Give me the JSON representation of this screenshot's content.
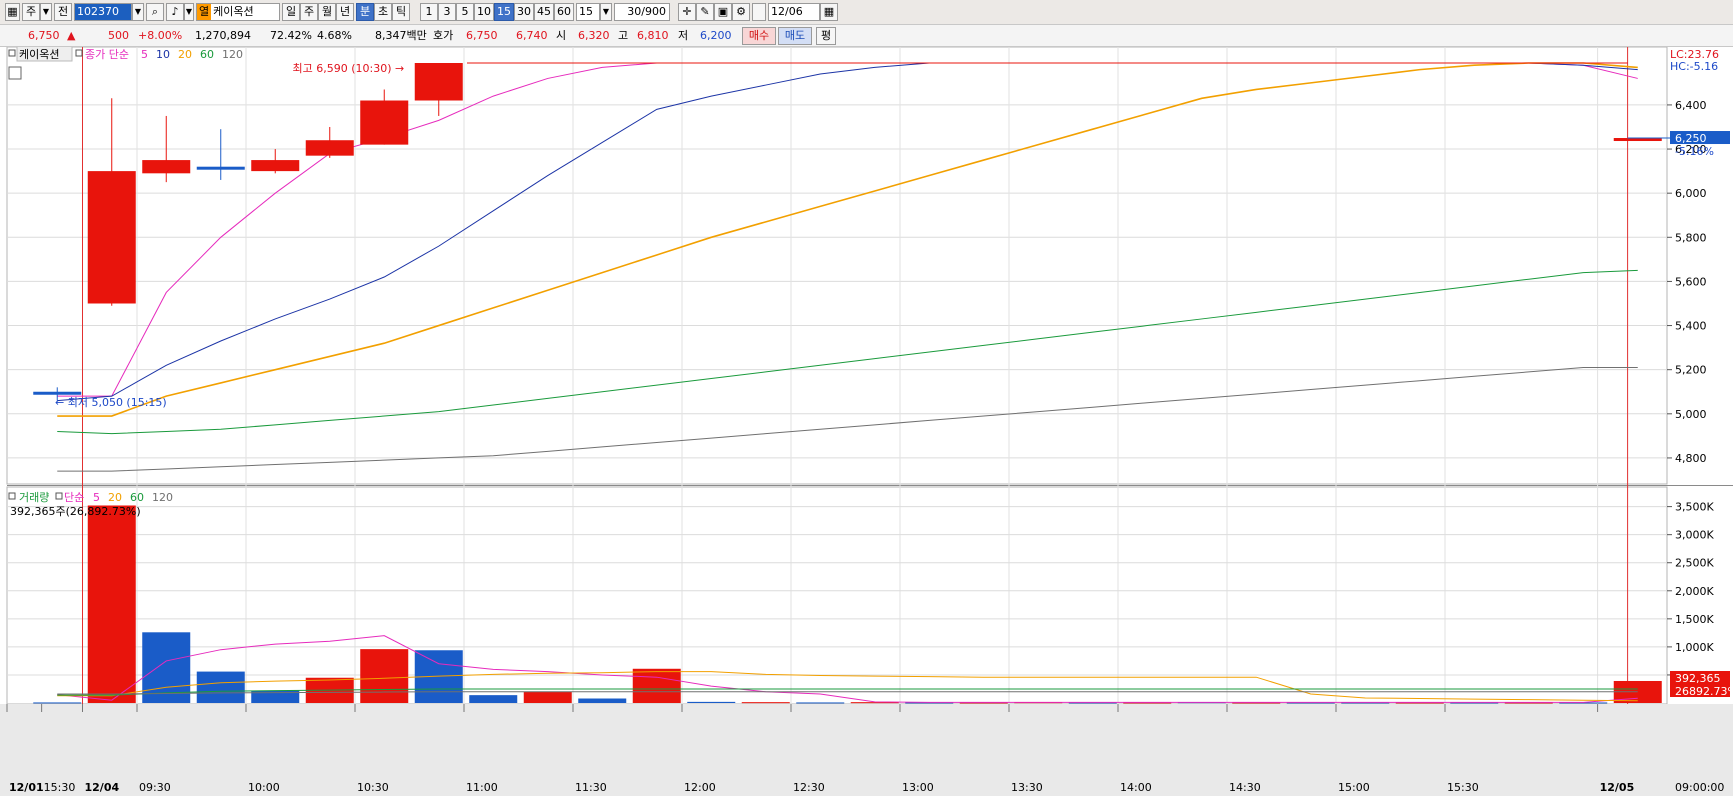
{
  "toolbar": {
    "day_label": "주",
    "prev_label": "전",
    "code": "102370",
    "name_tag": "열",
    "name": "케이옥션",
    "periods": [
      "일",
      "주",
      "월",
      "년",
      "분",
      "초",
      "틱"
    ],
    "selected_period": "분",
    "intervals": [
      "1",
      "3",
      "5",
      "10",
      "15",
      "30",
      "45",
      "60"
    ],
    "selected_interval": "15",
    "interval_value": "15",
    "count": "30/900",
    "date": "12/06",
    "dropdown_arrow": "▼",
    "icons": [
      "chart-type-icon",
      "search-icon",
      "sound-icon",
      "crosshair-icon",
      "draw-icon",
      "save-icon",
      "settings-icon",
      "calendar-icon"
    ]
  },
  "quote": {
    "price": "6,750",
    "change_arrow": "▲",
    "change": "500",
    "change_pct": "+8.00%",
    "volume": "1,270,894",
    "vol_ratio": "72.42%",
    "turnover": "4.68%",
    "amount": "8,347백만",
    "hoga_label": "호가",
    "ask": "6,750",
    "bid": "6,740",
    "open_label": "시",
    "open": "6,320",
    "high_label": "고",
    "high": "6,810",
    "low_label": "저",
    "low": "6,200",
    "buy_label": "매수",
    "sell_label": "매도",
    "avg_label": "평"
  },
  "colors": {
    "up": "#e8140c",
    "down": "#1a5cc8",
    "ma5": "#e62bbd",
    "ma10": "#1c34a6",
    "ma20": "#f2a000",
    "ma60": "#1a9a3c",
    "ma120": "#707070"
  },
  "chart_data": [
    {
      "type": "candlestick",
      "legend": {
        "title": "케이옥션",
        "ma_label": "종가 단순",
        "periods": [
          "5",
          "10",
          "20",
          "60",
          "120"
        ]
      },
      "right_label_lc": "LC:23.76",
      "right_label_hc": "HC:-5.16",
      "current_tag": "6,250",
      "current_pct": "-5.16%",
      "high_annotation": "최고 6,590 (10:30)",
      "low_annotation": "최저 5,050 (15:15)",
      "y_ticks": [
        "6,400",
        "6,200",
        "6,000",
        "5,800",
        "5,600",
        "5,400",
        "5,200",
        "5,000",
        "4,800"
      ],
      "y_tick_values": [
        6400,
        6200,
        6000,
        5800,
        5600,
        5400,
        5200,
        5000,
        4800
      ],
      "candles": [
        {
          "o": 5100,
          "h": 5120,
          "l": 5060,
          "c": 5100
        },
        {
          "o": 5500,
          "h": 6430,
          "l": 5490,
          "c": 6100
        },
        {
          "o": 6090,
          "h": 6350,
          "l": 6050,
          "c": 6150
        },
        {
          "o": 6120,
          "h": 6290,
          "l": 6060,
          "c": 6120
        },
        {
          "o": 6100,
          "h": 6200,
          "l": 6090,
          "c": 6150
        },
        {
          "o": 6170,
          "h": 6300,
          "l": 6160,
          "c": 6240
        },
        {
          "o": 6220,
          "h": 6470,
          "l": 6220,
          "c": 6420
        },
        {
          "o": 6420,
          "h": 6590,
          "l": 6350,
          "c": 6590
        },
        {
          "o": 6590,
          "h": 6590,
          "l": 6590,
          "c": 6590
        },
        {
          "o": 6590,
          "h": 6590,
          "l": 6590,
          "c": 6590
        },
        {
          "o": 6590,
          "h": 6590,
          "l": 6470,
          "c": 6590
        },
        {
          "o": 6590,
          "h": 6590,
          "l": 6590,
          "c": 6590
        },
        {
          "o": 6590,
          "h": 6590,
          "l": 6590,
          "c": 6590
        },
        {
          "o": 6590,
          "h": 6590,
          "l": 6590,
          "c": 6590
        },
        {
          "o": 6590,
          "h": 6590,
          "l": 6590,
          "c": 6590
        },
        {
          "o": 6590,
          "h": 6590,
          "l": 6590,
          "c": 6590
        },
        {
          "o": 6590,
          "h": 6590,
          "l": 6590,
          "c": 6590
        },
        {
          "o": 6590,
          "h": 6590,
          "l": 6590,
          "c": 6590
        },
        {
          "o": 6590,
          "h": 6590,
          "l": 6590,
          "c": 6590
        },
        {
          "o": 6590,
          "h": 6590,
          "l": 6590,
          "c": 6590
        },
        {
          "o": 6590,
          "h": 6590,
          "l": 6590,
          "c": 6590
        },
        {
          "o": 6590,
          "h": 6590,
          "l": 6590,
          "c": 6590
        },
        {
          "o": 6590,
          "h": 6590,
          "l": 6590,
          "c": 6590
        },
        {
          "o": 6590,
          "h": 6590,
          "l": 6590,
          "c": 6590
        },
        {
          "o": 6590,
          "h": 6590,
          "l": 6590,
          "c": 6590
        },
        {
          "o": 6590,
          "h": 6590,
          "l": 6590,
          "c": 6590
        },
        {
          "o": 6590,
          "h": 6590,
          "l": 6590,
          "c": 6590
        },
        {
          "o": 6590,
          "h": 6590,
          "l": 6590,
          "c": 6590
        },
        {
          "o": 6590,
          "h": 6590,
          "l": 6590,
          "c": 6590
        },
        {
          "o": 6250,
          "h": 6250,
          "l": 6250,
          "c": 6250
        }
      ],
      "ma_series": [
        {
          "period": "5",
          "values": [
            5080,
            5080,
            5550,
            5800,
            6000,
            6180,
            6250,
            6330,
            6440,
            6520,
            6570,
            6590,
            6590,
            6590,
            6590,
            6590,
            6590,
            6590,
            6590,
            6590,
            6590,
            6590,
            6590,
            6590,
            6590,
            6590,
            6590,
            6590,
            6580,
            6520
          ]
        },
        {
          "period": "10",
          "values": [
            5060,
            5080,
            5220,
            5330,
            5430,
            5520,
            5620,
            5760,
            5920,
            6080,
            6230,
            6380,
            6440,
            6490,
            6540,
            6570,
            6590,
            6590,
            6590,
            6590,
            6590,
            6590,
            6590,
            6590,
            6590,
            6590,
            6590,
            6590,
            6580,
            6560
          ]
        },
        {
          "period": "20",
          "values": [
            4990,
            4990,
            5080,
            5140,
            5200,
            5260,
            5320,
            5400,
            5480,
            5560,
            5640,
            5720,
            5800,
            5870,
            5940,
            6010,
            6080,
            6150,
            6220,
            6290,
            6360,
            6430,
            6470,
            6500,
            6530,
            6560,
            6580,
            6590,
            6590,
            6570
          ]
        },
        {
          "period": "60",
          "values": [
            4920,
            4910,
            4920,
            4930,
            4950,
            4970,
            4990,
            5010,
            5040,
            5070,
            5100,
            5130,
            5160,
            5190,
            5220,
            5250,
            5280,
            5310,
            5340,
            5370,
            5400,
            5430,
            5460,
            5490,
            5520,
            5550,
            5580,
            5610,
            5640,
            5650
          ]
        },
        {
          "period": "120",
          "values": [
            4740,
            4740,
            4750,
            4760,
            4770,
            4780,
            4790,
            4800,
            4810,
            4830,
            4850,
            4870,
            4890,
            4910,
            4930,
            4950,
            4970,
            4990,
            5010,
            5030,
            5050,
            5070,
            5090,
            5110,
            5130,
            5150,
            5170,
            5190,
            5210,
            5210
          ]
        }
      ]
    },
    {
      "type": "bar",
      "legend": {
        "title": "거래량",
        "ma_label": "단순",
        "periods": [
          "5",
          "20",
          "60",
          "120"
        ]
      },
      "summary": "392,365주(26,892.73%)",
      "y_ticks": [
        "3,500K",
        "3,000K",
        "2,500K",
        "2,000K",
        "1,500K",
        "1,000K",
        "500,000"
      ],
      "y_tick_values": [
        3500000,
        3000000,
        2500000,
        2000000,
        1500000,
        1000000,
        500000
      ],
      "current_tag": "392,365",
      "current_pct_tag": "26892.73%",
      "volumes": [
        {
          "v": 10000,
          "up": false
        },
        {
          "v": 3520000,
          "up": true
        },
        {
          "v": 1260000,
          "up": false
        },
        {
          "v": 560000,
          "up": false
        },
        {
          "v": 220000,
          "up": false
        },
        {
          "v": 450000,
          "up": true
        },
        {
          "v": 960000,
          "up": true
        },
        {
          "v": 940000,
          "up": false
        },
        {
          "v": 140000,
          "up": false
        },
        {
          "v": 200000,
          "up": true
        },
        {
          "v": 80000,
          "up": false
        },
        {
          "v": 610000,
          "up": true
        },
        {
          "v": 20000,
          "up": false
        },
        {
          "v": 15000,
          "up": true
        },
        {
          "v": 10000,
          "up": false
        },
        {
          "v": 15000,
          "up": true
        },
        {
          "v": 10000,
          "up": false
        },
        {
          "v": 10000,
          "up": true
        },
        {
          "v": 15000,
          "up": true
        },
        {
          "v": 10000,
          "up": false
        },
        {
          "v": 10000,
          "up": true
        },
        {
          "v": 15000,
          "up": false
        },
        {
          "v": 10000,
          "up": true
        },
        {
          "v": 10000,
          "up": false
        },
        {
          "v": 10000,
          "up": false
        },
        {
          "v": 10000,
          "up": true
        },
        {
          "v": 10000,
          "up": false
        },
        {
          "v": 10000,
          "up": true
        },
        {
          "v": 10000,
          "up": false
        },
        {
          "v": 392365,
          "up": true
        }
      ],
      "ma_series": [
        {
          "period": "5",
          "values": [
            150000,
            50000,
            750000,
            950000,
            1050000,
            1100000,
            1200000,
            700000,
            600000,
            560000,
            500000,
            460000,
            300000,
            200000,
            160000,
            20000,
            12000,
            12000,
            12000,
            12000,
            12000,
            12000,
            12000,
            12000,
            12000,
            12000,
            12000,
            12000,
            12000,
            85000
          ]
        },
        {
          "period": "20",
          "values": [
            130000,
            130000,
            280000,
            360000,
            390000,
            410000,
            440000,
            480000,
            510000,
            530000,
            540000,
            560000,
            560000,
            510000,
            490000,
            480000,
            470000,
            460000,
            460000,
            460000,
            460000,
            460000,
            460000,
            160000,
            90000,
            80000,
            70000,
            60000,
            50000,
            40000
          ]
        },
        {
          "period": "60",
          "values": [
            140000,
            140000,
            180000,
            210000,
            220000,
            230000,
            240000,
            250000,
            250000,
            250000,
            250000,
            250000,
            250000,
            250000,
            250000,
            250000,
            250000,
            250000,
            250000,
            250000,
            250000,
            250000,
            250000,
            250000,
            250000,
            250000,
            250000,
            250000,
            250000,
            250000
          ]
        },
        {
          "period": "120",
          "values": [
            160000,
            160000,
            170000,
            180000,
            185000,
            190000,
            195000,
            200000,
            200000,
            200000,
            200000,
            200000,
            200000,
            200000,
            200000,
            200000,
            200000,
            200000,
            200000,
            200000,
            200000,
            200000,
            200000,
            200000,
            200000,
            200000,
            200000,
            200000,
            200000,
            200000
          ]
        }
      ]
    }
  ],
  "x_axis": {
    "labels": [
      "12/01",
      "15:30",
      "12/04",
      "09:30",
      "10:00",
      "10:30",
      "11:00",
      "11:30",
      "12:00",
      "12:30",
      "13:00",
      "13:30",
      "14:00",
      "14:30",
      "15:00",
      "15:30",
      "12/05"
    ],
    "label_index": [
      -0.5,
      0.25,
      1,
      2,
      4,
      6,
      8,
      10,
      12,
      14,
      16,
      18,
      20,
      22,
      24,
      26,
      28.8
    ],
    "right_label": "09:00:00"
  }
}
